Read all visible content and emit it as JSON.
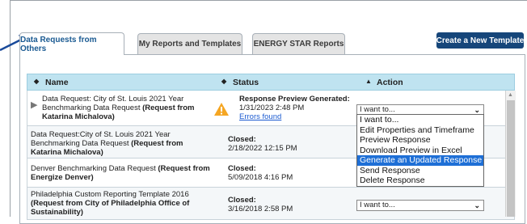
{
  "tabs": [
    {
      "label": "Data Requests from Others"
    },
    {
      "label": "My Reports and Templates"
    },
    {
      "label": "ENERGY STAR Reports"
    }
  ],
  "create_button": "Create a New Template",
  "columns": {
    "name": "Name",
    "status": "Status",
    "action": "Action"
  },
  "rows": [
    {
      "name_lines": [
        "Data Request: City of St. Louis 2021 Year",
        "Benchmarking Data Request "
      ],
      "name_bold_a": "(Request from",
      "name_bold_b": "Katarina Michalova)",
      "status_title": "Response Preview Generated:",
      "status_date": "1/31/2023 2:48 PM",
      "status_link": "Errors found",
      "action": "I want to..."
    },
    {
      "name_lines": [
        "Data Request:City of St. Louis 2021 Year",
        "Benchmarking Data Request "
      ],
      "name_bold_a": "(Request from",
      "name_bold_b": "Katarina Michalova)",
      "status_title": "Closed:",
      "status_date": "2/18/2022 12:15 PM"
    },
    {
      "name_lines": [
        "Denver Benchmarking Data Request "
      ],
      "name_bold_a": "(Request from",
      "name_bold_b": "Energize Denver)",
      "status_title": "Closed:",
      "status_date": "5/09/2018 4:16 PM"
    },
    {
      "name_lines": [
        "Philadelphia Custom Reporting Template 2016"
      ],
      "name_bold_a": "(Request from City of Philadelphia Office of",
      "name_bold_b": "Sustainability)",
      "status_title": "Closed:",
      "status_date": "3/16/2018 2:58 PM",
      "action": "I want to..."
    }
  ],
  "dropdown_options": [
    "I want to...",
    "Edit Properties and Timeframe",
    "Preview Response",
    "Download Preview in Excel",
    "Generate an Updated Response",
    "Send Response",
    "Delete Response"
  ],
  "selected_option_index": 4,
  "colors": {
    "header_bg": "#bfe3f0",
    "button_bg": "#16467a",
    "selected_bg": "#1e6fd6",
    "warning": "#f5a623"
  }
}
